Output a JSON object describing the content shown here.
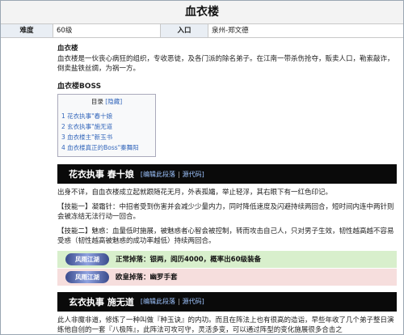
{
  "page": {
    "title": "血衣楼"
  },
  "info": {
    "difficulty_label": "难度",
    "difficulty_value": "60级",
    "entry_label": "入口",
    "entry_value": "泉州-郑文德"
  },
  "org": {
    "heading": "血衣楼",
    "description": "血衣楼是一伙丧心病狂的组织，专收恶徒，及各门派的除名弟子。在江南一带杀伤抢夺，贩卖人口，勒索敲诈，倒卖盐铁丝绸，为祸一方。"
  },
  "boss": {
    "heading": "血衣楼BOSS",
    "toc_title": "目录",
    "toc_toggle": "[隐藏]",
    "toc_items": [
      "1  花衣执事\"春十娘",
      "2  玄衣执事\"施无道",
      "3  血衣楼主\"新玉书",
      "4  血衣楼真正的Boss\"秦舞阳"
    ]
  },
  "sections": [
    {
      "title": "花衣执事 春十娘",
      "edit_link": "[编辑此段落",
      "source_link": "源代码]",
      "paragraphs": [
        "出身不详，自血衣楼成立起就跟随花无月，外表孤孀，举止轻浮，其右眼下有一红色印记。",
        "【技能一】凝霜针：中招者受到伤害并会减少少量内力，同时降低速度及闪避持续两回合，短时间内连中两针则会被冻结无法行动一回合。",
        "【技能二】魅惑：血量低时施展，被魅惑者心智会被控制，转而攻击自己人，只对男子生效，韧性越高越不容易受惑（韧性越高被魅惑的成功率越低）持续两回合。"
      ],
      "drops": [
        {
          "logo": "风雨江湖",
          "text": "正常掉落：银两，阅历4000，概率出60级装备"
        },
        {
          "logo": "风雨江湖",
          "text": "欧皇掉落：幽罗手套"
        }
      ]
    },
    {
      "title": "玄衣执事 施无道",
      "edit_link": "[编辑此段落",
      "source_link": "源代码]",
      "paragraphs": [
        "此人非魔非道，修炼了一种叫做『种玉诀』的内功。而且在阵法上也有很高的造诣，早些年收了几个弟子整日演练他自创的一套『八极阵』，此阵法可攻可守，灵活多变，可以通过阵型的变化施展很多合击之"
      ]
    }
  ]
}
